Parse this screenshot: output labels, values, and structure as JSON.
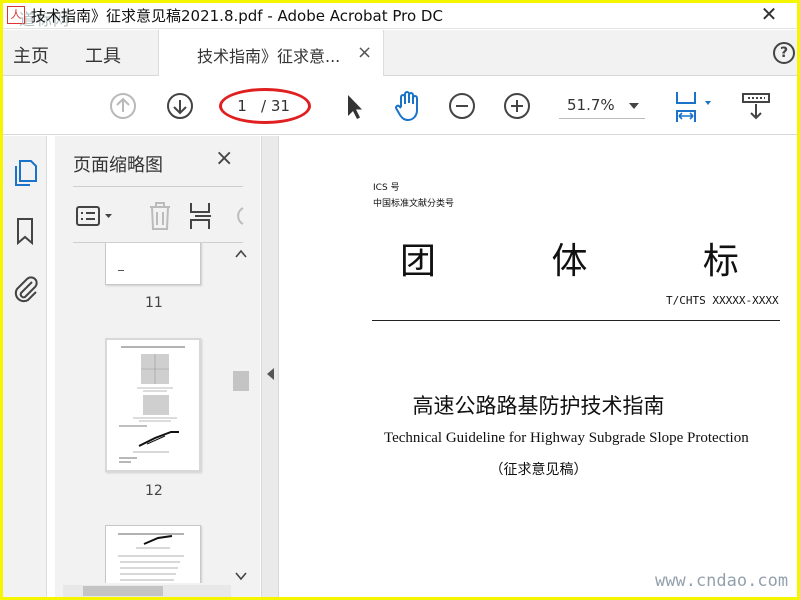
{
  "window": {
    "title": "技术指南》征求意见稿2021.8.pdf - Adobe Acrobat Pro DC",
    "close_glyph": "✕",
    "watermark_top": "道标网"
  },
  "menu": {
    "home": "主页",
    "tools": "工具",
    "tab_label": "技术指南》征求意...",
    "tab_close": "×",
    "help": "?"
  },
  "toolbar": {
    "page_current": "1",
    "page_total": "/ 31",
    "zoom": "51.7%",
    "icons": [
      "prev-page-icon",
      "next-page-icon",
      "select-arrow-icon",
      "hand-tool-icon",
      "zoom-out-icon",
      "zoom-in-icon",
      "fit-page-icon",
      "comment-scroll-icon"
    ]
  },
  "rail": {
    "icons": [
      "page-thumbnails-icon",
      "bookmark-icon",
      "attachment-icon"
    ]
  },
  "thumbnails_panel": {
    "title": "页面缩略图",
    "close": "×",
    "icons": [
      "options-icon",
      "delete-icon",
      "insert-page-icon",
      "rotate-icon"
    ],
    "pages": [
      {
        "number": "11"
      },
      {
        "number": "12"
      }
    ]
  },
  "document": {
    "ics": "ICS 号",
    "ccs": "中国标准文献分类号",
    "heading": "团 体 标 准",
    "code": "T/CHTS XXXXX-XXXX",
    "title_zh": "高速公路路基防护技术指南",
    "title_en": "Technical Guideline for Highway Subgrade Slope Protection",
    "draft_label": "（征求意见稿）"
  },
  "watermark_bottom": "www.cndao.com",
  "colors": {
    "accent_blue": "#1a73c8",
    "highlight_red": "#e02020",
    "border_yellow": "#f5f500"
  }
}
